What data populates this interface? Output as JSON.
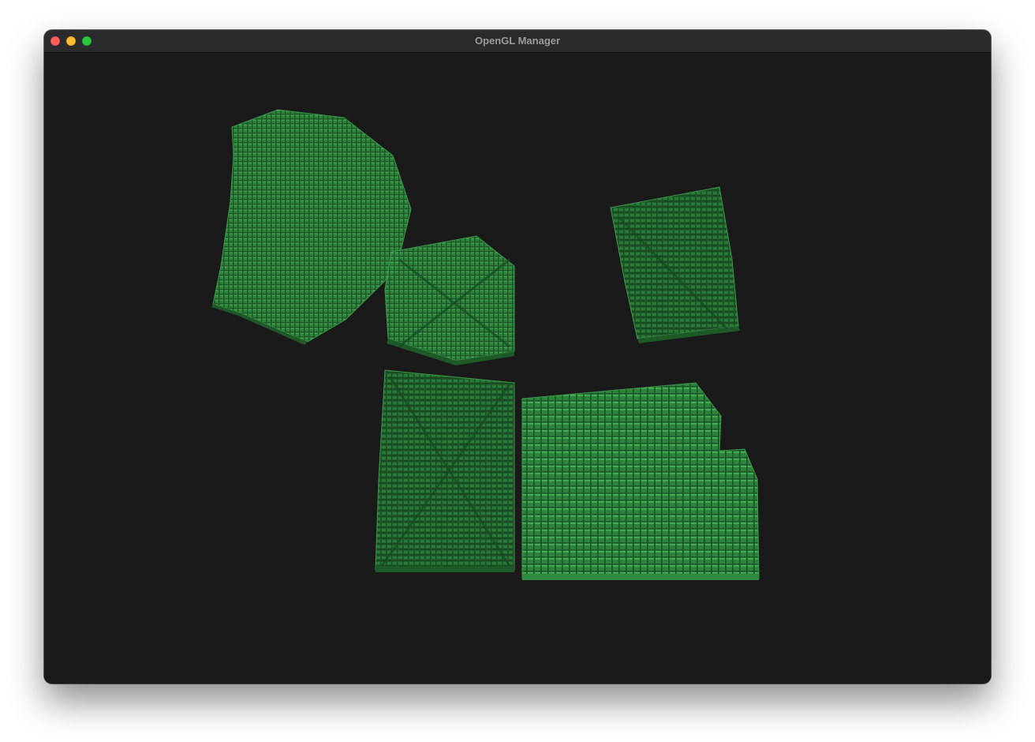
{
  "window": {
    "title": "OpenGL Manager",
    "controls": {
      "close_color": "#ff5f57",
      "minimize_color": "#febc2e",
      "zoom_color": "#28c840"
    }
  },
  "viewport": {
    "background": "#1a1a1a",
    "voxel_color": "#2f8a3e",
    "voxel_highlight": "#45b556",
    "voxel_shadow": "#1d5a28",
    "objects": [
      {
        "name": "voxel-object-top-left"
      },
      {
        "name": "voxel-object-center-cube"
      },
      {
        "name": "voxel-object-right-tilted"
      },
      {
        "name": "voxel-object-bottom-left-panel"
      },
      {
        "name": "voxel-object-bottom-right-slab"
      }
    ]
  }
}
